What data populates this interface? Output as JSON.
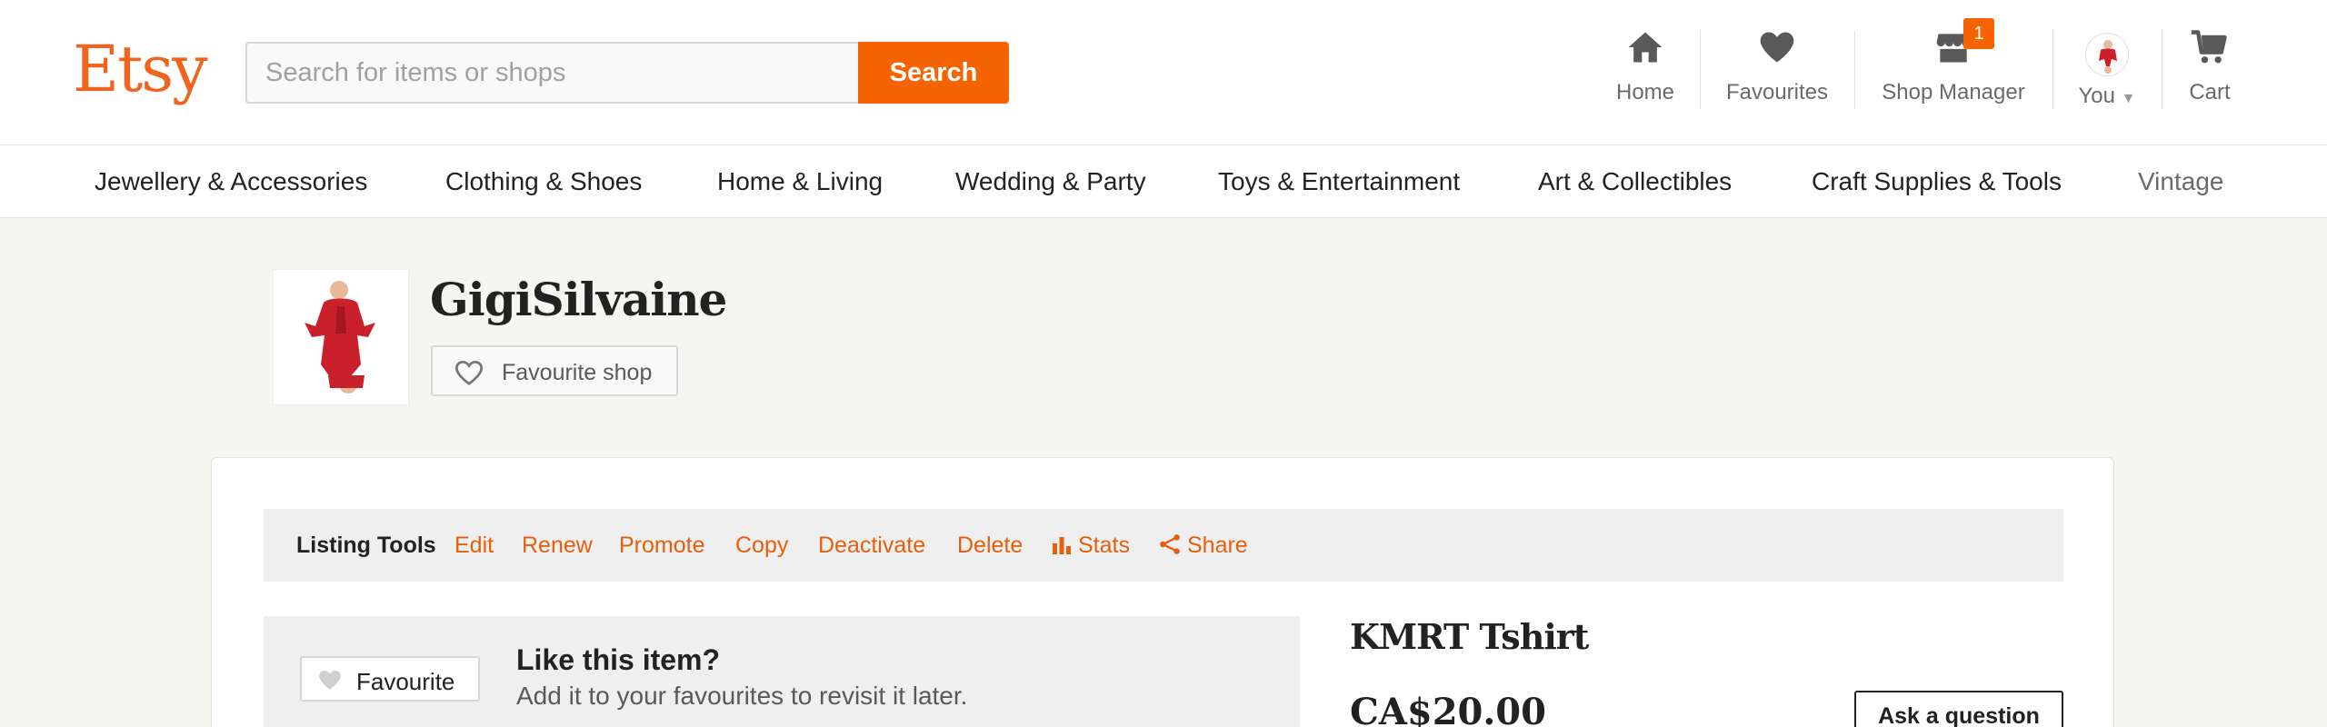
{
  "header": {
    "logo": "Etsy",
    "search": {
      "placeholder": "Search for items or shops",
      "value": "",
      "button_label": "Search"
    },
    "nav": {
      "home": "Home",
      "favourites": "Favourites",
      "shop_manager": "Shop Manager",
      "shop_manager_badge": "1",
      "you": "You",
      "cart": "Cart"
    }
  },
  "categories": [
    "Jewellery & Accessories",
    "Clothing & Shoes",
    "Home & Living",
    "Wedding & Party",
    "Toys & Entertainment",
    "Art & Collectibles",
    "Craft Supplies & Tools",
    "Vintage"
  ],
  "shop": {
    "name": "GigiSilvaine",
    "favourite_shop_label": "Favourite shop"
  },
  "listing_tools": {
    "title": "Listing Tools",
    "actions": [
      "Edit",
      "Renew",
      "Promote",
      "Copy",
      "Deactivate",
      "Delete",
      "Stats",
      "Share"
    ]
  },
  "like_panel": {
    "button_label": "Favourite",
    "title": "Like this item?",
    "subtitle": "Add it to your favourites to revisit it later."
  },
  "item": {
    "title": "KMRT Tshirt",
    "price": "CA$20.00",
    "ask_label": "Ask a question"
  },
  "colors": {
    "brand": "#f1641e",
    "button": "#f56400",
    "action_link": "#e5600e",
    "background": "#f5f5f1"
  },
  "icons": {
    "home": "home-icon",
    "favourites": "heart-icon",
    "shop_manager": "shop-icon",
    "you": "avatar",
    "cart": "cart-icon",
    "stats": "bar-chart-icon",
    "share": "share-icon"
  }
}
